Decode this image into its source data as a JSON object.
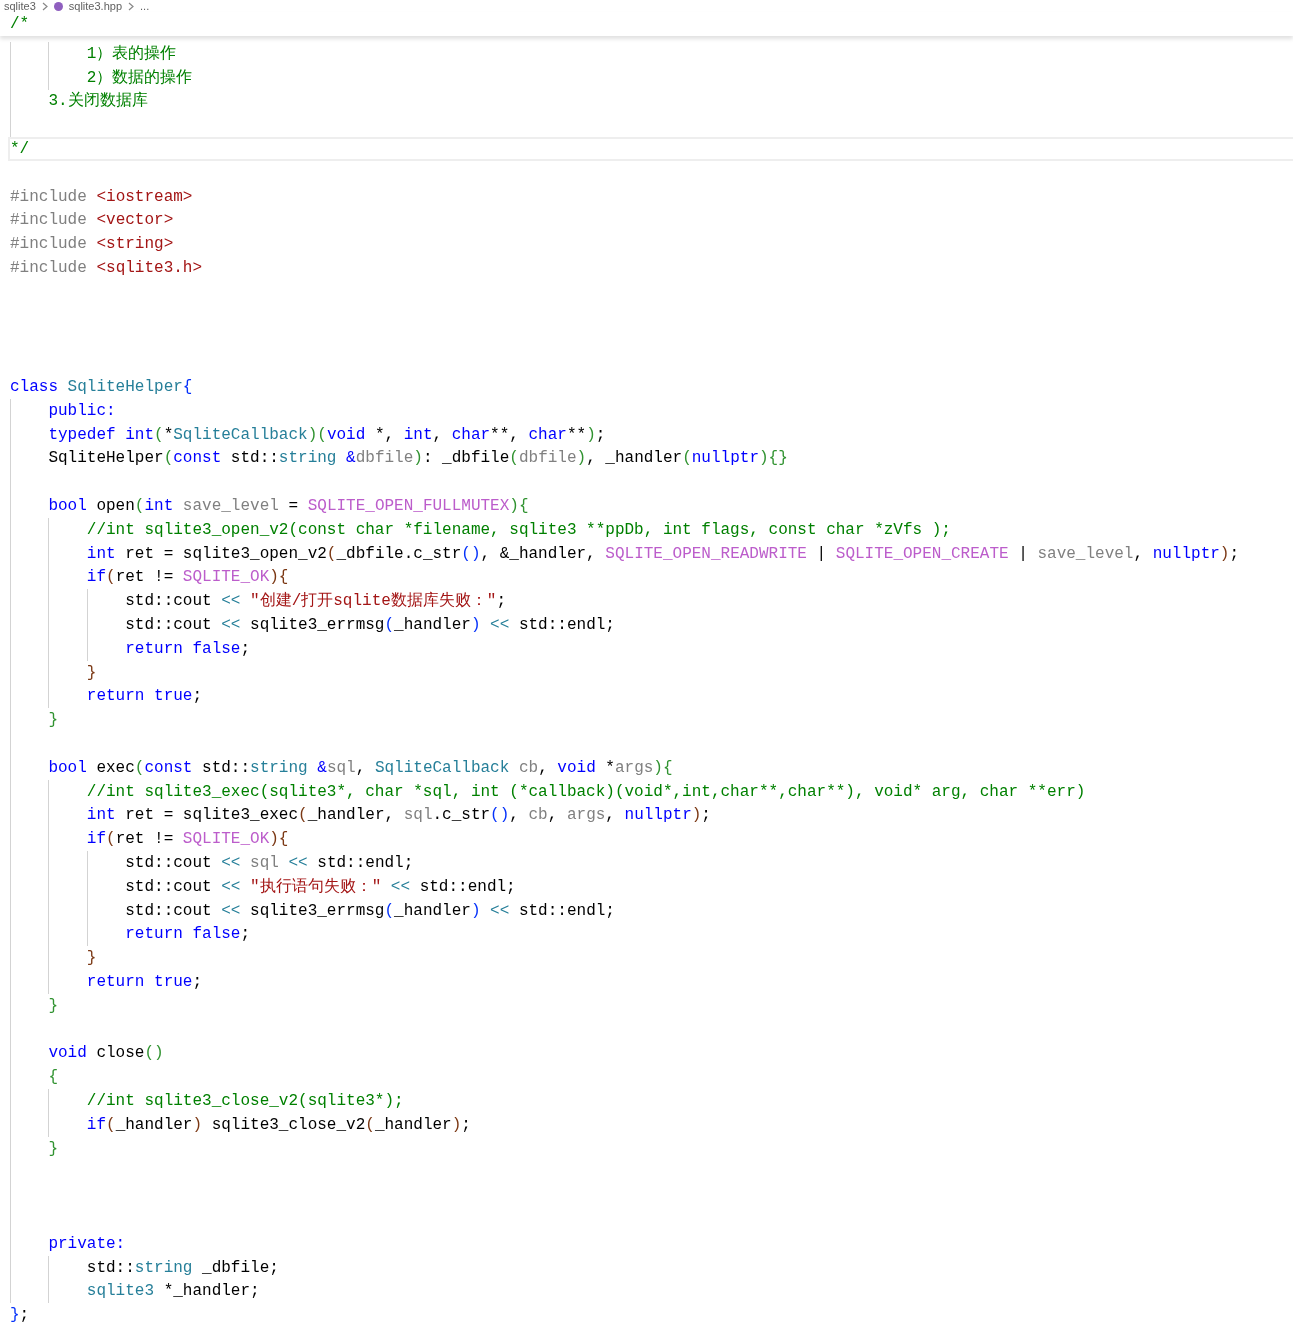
{
  "breadcrumb": {
    "folder": "sqlite3",
    "file": "sqlite3.hpp",
    "more": "..."
  },
  "sticky_line": "/*",
  "lines": [
    {
      "current": false,
      "tokens": [
        {
          "text": "        1）表的操作",
          "kind": "cm"
        }
      ]
    },
    {
      "current": false,
      "tokens": [
        {
          "text": "        2）数据的操作",
          "kind": "cm"
        }
      ]
    },
    {
      "current": false,
      "tokens": [
        {
          "text": "    3.关闭数据库",
          "kind": "cm"
        }
      ]
    },
    {
      "current": false
    },
    {
      "current": true,
      "tokens": [
        {
          "text": "*/",
          "kind": "cm"
        }
      ]
    },
    {
      "current": false
    },
    {
      "current": false,
      "tokens": [
        {
          "text": "#include ",
          "kind": "pre"
        },
        {
          "text": "<iostream>",
          "kind": "str"
        }
      ]
    },
    {
      "current": false,
      "tokens": [
        {
          "text": "#include ",
          "kind": "pre"
        },
        {
          "text": "<vector>",
          "kind": "str"
        }
      ]
    },
    {
      "current": false,
      "tokens": [
        {
          "text": "#include ",
          "kind": "pre"
        },
        {
          "text": "<string>",
          "kind": "str"
        }
      ]
    },
    {
      "current": false,
      "tokens": [
        {
          "text": "#include ",
          "kind": "pre"
        },
        {
          "text": "<sqlite3.h>",
          "kind": "str"
        }
      ]
    },
    {
      "current": false
    },
    {
      "current": false
    },
    {
      "current": false
    },
    {
      "current": false
    },
    {
      "current": false,
      "tokens": [
        {
          "text": "class ",
          "kind": "kw"
        },
        {
          "text": "SqliteHelper",
          "kind": "type"
        },
        {
          "text": "{",
          "kind": "b1"
        }
      ]
    },
    {
      "current": false,
      "tokens": [
        {
          "text": "    public:",
          "kind": "kw"
        }
      ]
    },
    {
      "current": false,
      "tokens": [
        {
          "text": "    typedef int",
          "kind": "kw"
        },
        {
          "text": "(",
          "kind": "b2"
        },
        {
          "text": "*",
          "kind": "plain"
        },
        {
          "text": "SqliteCallback",
          "kind": "type"
        },
        {
          "text": ")(",
          "kind": "b2"
        },
        {
          "text": "void",
          "kind": "kw"
        },
        {
          "text": " *, ",
          "kind": "plain"
        },
        {
          "text": "int",
          "kind": "kw"
        },
        {
          "text": ", ",
          "kind": "plain"
        },
        {
          "text": "char",
          "kind": "kw"
        },
        {
          "text": "**, ",
          "kind": "plain"
        },
        {
          "text": "char",
          "kind": "kw"
        },
        {
          "text": "**",
          "kind": "plain"
        },
        {
          "text": ")",
          "kind": "b2"
        },
        {
          "text": ";",
          "kind": "plain"
        }
      ]
    },
    {
      "current": false,
      "tokens": [
        {
          "text": "    SqliteHelper",
          "kind": "plain"
        },
        {
          "text": "(",
          "kind": "b2"
        },
        {
          "text": "const",
          "kind": "kw"
        },
        {
          "text": " std::",
          "kind": "plain"
        },
        {
          "text": "string",
          "kind": "type"
        },
        {
          "text": " &",
          "kind": "kw"
        },
        {
          "text": "dbfile",
          "kind": "param"
        },
        {
          "text": ")",
          "kind": "b2"
        },
        {
          "text": ": _dbfile",
          "kind": "plain"
        },
        {
          "text": "(",
          "kind": "b2"
        },
        {
          "text": "dbfile",
          "kind": "param"
        },
        {
          "text": ")",
          "kind": "b2"
        },
        {
          "text": ", _handler",
          "kind": "plain"
        },
        {
          "text": "(",
          "kind": "b2"
        },
        {
          "text": "nullptr",
          "kind": "kw"
        },
        {
          "text": "){}",
          "kind": "b2"
        }
      ]
    },
    {
      "current": false
    },
    {
      "current": false,
      "tokens": [
        {
          "text": "    bool",
          "kind": "kw"
        },
        {
          "text": " open",
          "kind": "plain"
        },
        {
          "text": "(",
          "kind": "b2"
        },
        {
          "text": "int",
          "kind": "kw"
        },
        {
          "text": " save_level",
          "kind": "param"
        },
        {
          "text": " = ",
          "kind": "plain"
        },
        {
          "text": "SQLITE_OPEN_FULLMUTEX",
          "kind": "mac"
        },
        {
          "text": "){",
          "kind": "b2"
        }
      ]
    },
    {
      "current": false,
      "tokens": [
        {
          "text": "        //int sqlite3_open_v2(const char *filename, sqlite3 **ppDb, int flags, const char *zVfs );",
          "kind": "cm"
        }
      ]
    },
    {
      "current": false,
      "tokens": [
        {
          "text": "        int",
          "kind": "kw"
        },
        {
          "text": " ret = sqlite3_open_v2",
          "kind": "plain"
        },
        {
          "text": "(",
          "kind": "b3"
        },
        {
          "text": "_dbfile.c_str",
          "kind": "plain"
        },
        {
          "text": "()",
          "kind": "b1"
        },
        {
          "text": ", &_handler, ",
          "kind": "plain"
        },
        {
          "text": "SQLITE_OPEN_READWRITE",
          "kind": "mac"
        },
        {
          "text": " | ",
          "kind": "plain"
        },
        {
          "text": "SQLITE_OPEN_CREATE",
          "kind": "mac"
        },
        {
          "text": " | ",
          "kind": "plain"
        },
        {
          "text": "save_level",
          "kind": "param"
        },
        {
          "text": ", ",
          "kind": "plain"
        },
        {
          "text": "nullptr",
          "kind": "kw"
        },
        {
          "text": ")",
          "kind": "b3"
        },
        {
          "text": ";",
          "kind": "plain"
        }
      ]
    },
    {
      "current": false,
      "tokens": [
        {
          "text": "        if",
          "kind": "kw"
        },
        {
          "text": "(",
          "kind": "b3"
        },
        {
          "text": "ret != ",
          "kind": "plain"
        },
        {
          "text": "SQLITE_OK",
          "kind": "mac"
        },
        {
          "text": "){",
          "kind": "b3"
        }
      ]
    },
    {
      "current": false,
      "tokens": [
        {
          "text": "            std::cout ",
          "kind": "plain"
        },
        {
          "text": "<< ",
          "kind": "op"
        },
        {
          "text": "\"创建/打开sqlite数据库失败：\"",
          "kind": "str"
        },
        {
          "text": ";",
          "kind": "plain"
        }
      ]
    },
    {
      "current": false,
      "tokens": [
        {
          "text": "            std::cout ",
          "kind": "plain"
        },
        {
          "text": "<<",
          "kind": "op"
        },
        {
          "text": " sqlite3_errmsg",
          "kind": "plain"
        },
        {
          "text": "(",
          "kind": "b1"
        },
        {
          "text": "_handler",
          "kind": "plain"
        },
        {
          "text": ")",
          "kind": "b1"
        },
        {
          "text": " <<",
          "kind": "op"
        },
        {
          "text": " std::endl;",
          "kind": "plain"
        }
      ]
    },
    {
      "current": false,
      "tokens": [
        {
          "text": "            return false",
          "kind": "kw"
        },
        {
          "text": ";",
          "kind": "plain"
        }
      ]
    },
    {
      "current": false,
      "tokens": [
        {
          "text": "        }",
          "kind": "b3"
        }
      ]
    },
    {
      "current": false,
      "tokens": [
        {
          "text": "        return true",
          "kind": "kw"
        },
        {
          "text": ";",
          "kind": "plain"
        }
      ]
    },
    {
      "current": false,
      "tokens": [
        {
          "text": "    }",
          "kind": "b2"
        }
      ]
    },
    {
      "current": false
    },
    {
      "current": false,
      "tokens": [
        {
          "text": "    bool",
          "kind": "kw"
        },
        {
          "text": " exec",
          "kind": "plain"
        },
        {
          "text": "(",
          "kind": "b2"
        },
        {
          "text": "const",
          "kind": "kw"
        },
        {
          "text": " std::",
          "kind": "plain"
        },
        {
          "text": "string",
          "kind": "type"
        },
        {
          "text": " &",
          "kind": "kw"
        },
        {
          "text": "sql",
          "kind": "param"
        },
        {
          "text": ", ",
          "kind": "plain"
        },
        {
          "text": "SqliteCallback",
          "kind": "type"
        },
        {
          "text": " cb",
          "kind": "param"
        },
        {
          "text": ", ",
          "kind": "plain"
        },
        {
          "text": "void",
          "kind": "kw"
        },
        {
          "text": " *",
          "kind": "plain"
        },
        {
          "text": "args",
          "kind": "param"
        },
        {
          "text": "){",
          "kind": "b2"
        }
      ]
    },
    {
      "current": false,
      "tokens": [
        {
          "text": "        //int sqlite3_exec(sqlite3*, char *sql, int (*callback)(void*,int,char**,char**), void* arg, char **err)",
          "kind": "cm"
        }
      ]
    },
    {
      "current": false,
      "tokens": [
        {
          "text": "        int",
          "kind": "kw"
        },
        {
          "text": " ret = sqlite3_exec",
          "kind": "plain"
        },
        {
          "text": "(",
          "kind": "b3"
        },
        {
          "text": "_handler, ",
          "kind": "plain"
        },
        {
          "text": "sql",
          "kind": "param"
        },
        {
          "text": ".c_str",
          "kind": "plain"
        },
        {
          "text": "()",
          "kind": "b1"
        },
        {
          "text": ", ",
          "kind": "plain"
        },
        {
          "text": "cb",
          "kind": "param"
        },
        {
          "text": ", ",
          "kind": "plain"
        },
        {
          "text": "args",
          "kind": "param"
        },
        {
          "text": ", ",
          "kind": "plain"
        },
        {
          "text": "nullptr",
          "kind": "kw"
        },
        {
          "text": ")",
          "kind": "b3"
        },
        {
          "text": ";",
          "kind": "plain"
        }
      ]
    },
    {
      "current": false,
      "tokens": [
        {
          "text": "        if",
          "kind": "kw"
        },
        {
          "text": "(",
          "kind": "b3"
        },
        {
          "text": "ret != ",
          "kind": "plain"
        },
        {
          "text": "SQLITE_OK",
          "kind": "mac"
        },
        {
          "text": "){",
          "kind": "b3"
        }
      ]
    },
    {
      "current": false,
      "tokens": [
        {
          "text": "            std::cout ",
          "kind": "plain"
        },
        {
          "text": "<< ",
          "kind": "op"
        },
        {
          "text": "sql",
          "kind": "param"
        },
        {
          "text": " <<",
          "kind": "op"
        },
        {
          "text": " std::endl;",
          "kind": "plain"
        }
      ]
    },
    {
      "current": false,
      "tokens": [
        {
          "text": "            std::cout ",
          "kind": "plain"
        },
        {
          "text": "<< ",
          "kind": "op"
        },
        {
          "text": "\"执行语句失败：\"",
          "kind": "str"
        },
        {
          "text": " <<",
          "kind": "op"
        },
        {
          "text": " std::endl;",
          "kind": "plain"
        }
      ]
    },
    {
      "current": false,
      "tokens": [
        {
          "text": "            std::cout ",
          "kind": "plain"
        },
        {
          "text": "<<",
          "kind": "op"
        },
        {
          "text": " sqlite3_errmsg",
          "kind": "plain"
        },
        {
          "text": "(",
          "kind": "b1"
        },
        {
          "text": "_handler",
          "kind": "plain"
        },
        {
          "text": ")",
          "kind": "b1"
        },
        {
          "text": " <<",
          "kind": "op"
        },
        {
          "text": " std::endl;",
          "kind": "plain"
        }
      ]
    },
    {
      "current": false,
      "tokens": [
        {
          "text": "            return false",
          "kind": "kw"
        },
        {
          "text": ";",
          "kind": "plain"
        }
      ]
    },
    {
      "current": false,
      "tokens": [
        {
          "text": "        }",
          "kind": "b3"
        }
      ]
    },
    {
      "current": false,
      "tokens": [
        {
          "text": "        return true",
          "kind": "kw"
        },
        {
          "text": ";",
          "kind": "plain"
        }
      ]
    },
    {
      "current": false,
      "tokens": [
        {
          "text": "    }",
          "kind": "b2"
        }
      ]
    },
    {
      "current": false
    },
    {
      "current": false,
      "tokens": [
        {
          "text": "    void",
          "kind": "kw"
        },
        {
          "text": " close",
          "kind": "plain"
        },
        {
          "text": "()",
          "kind": "b2"
        }
      ]
    },
    {
      "current": false,
      "tokens": [
        {
          "text": "    {",
          "kind": "b2"
        }
      ]
    },
    {
      "current": false,
      "tokens": [
        {
          "text": "        //int sqlite3_close_v2(sqlite3*);",
          "kind": "cm"
        }
      ]
    },
    {
      "current": false,
      "tokens": [
        {
          "text": "        if",
          "kind": "kw"
        },
        {
          "text": "(",
          "kind": "b3"
        },
        {
          "text": "_handler",
          "kind": "plain"
        },
        {
          "text": ")",
          "kind": "b3"
        },
        {
          "text": " sqlite3_close_v2",
          "kind": "plain"
        },
        {
          "text": "(",
          "kind": "b3"
        },
        {
          "text": "_handler",
          "kind": "plain"
        },
        {
          "text": ")",
          "kind": "b3"
        },
        {
          "text": ";",
          "kind": "plain"
        }
      ]
    },
    {
      "current": false,
      "tokens": [
        {
          "text": "    }",
          "kind": "b2"
        }
      ]
    },
    {
      "current": false
    },
    {
      "current": false
    },
    {
      "current": false
    },
    {
      "current": false,
      "tokens": [
        {
          "text": "    private:",
          "kind": "kw"
        }
      ]
    },
    {
      "current": false,
      "tokens": [
        {
          "text": "        std::",
          "kind": "plain"
        },
        {
          "text": "string",
          "kind": "type"
        },
        {
          "text": " _dbfile;",
          "kind": "plain"
        }
      ]
    },
    {
      "current": false,
      "tokens": [
        {
          "text": "        sqlite3",
          "kind": "type"
        },
        {
          "text": " *_handler;",
          "kind": "plain"
        }
      ]
    },
    {
      "current": false,
      "tokens": [
        {
          "text": "}",
          "kind": "b1"
        },
        {
          "text": ";",
          "kind": "plain"
        }
      ]
    }
  ]
}
